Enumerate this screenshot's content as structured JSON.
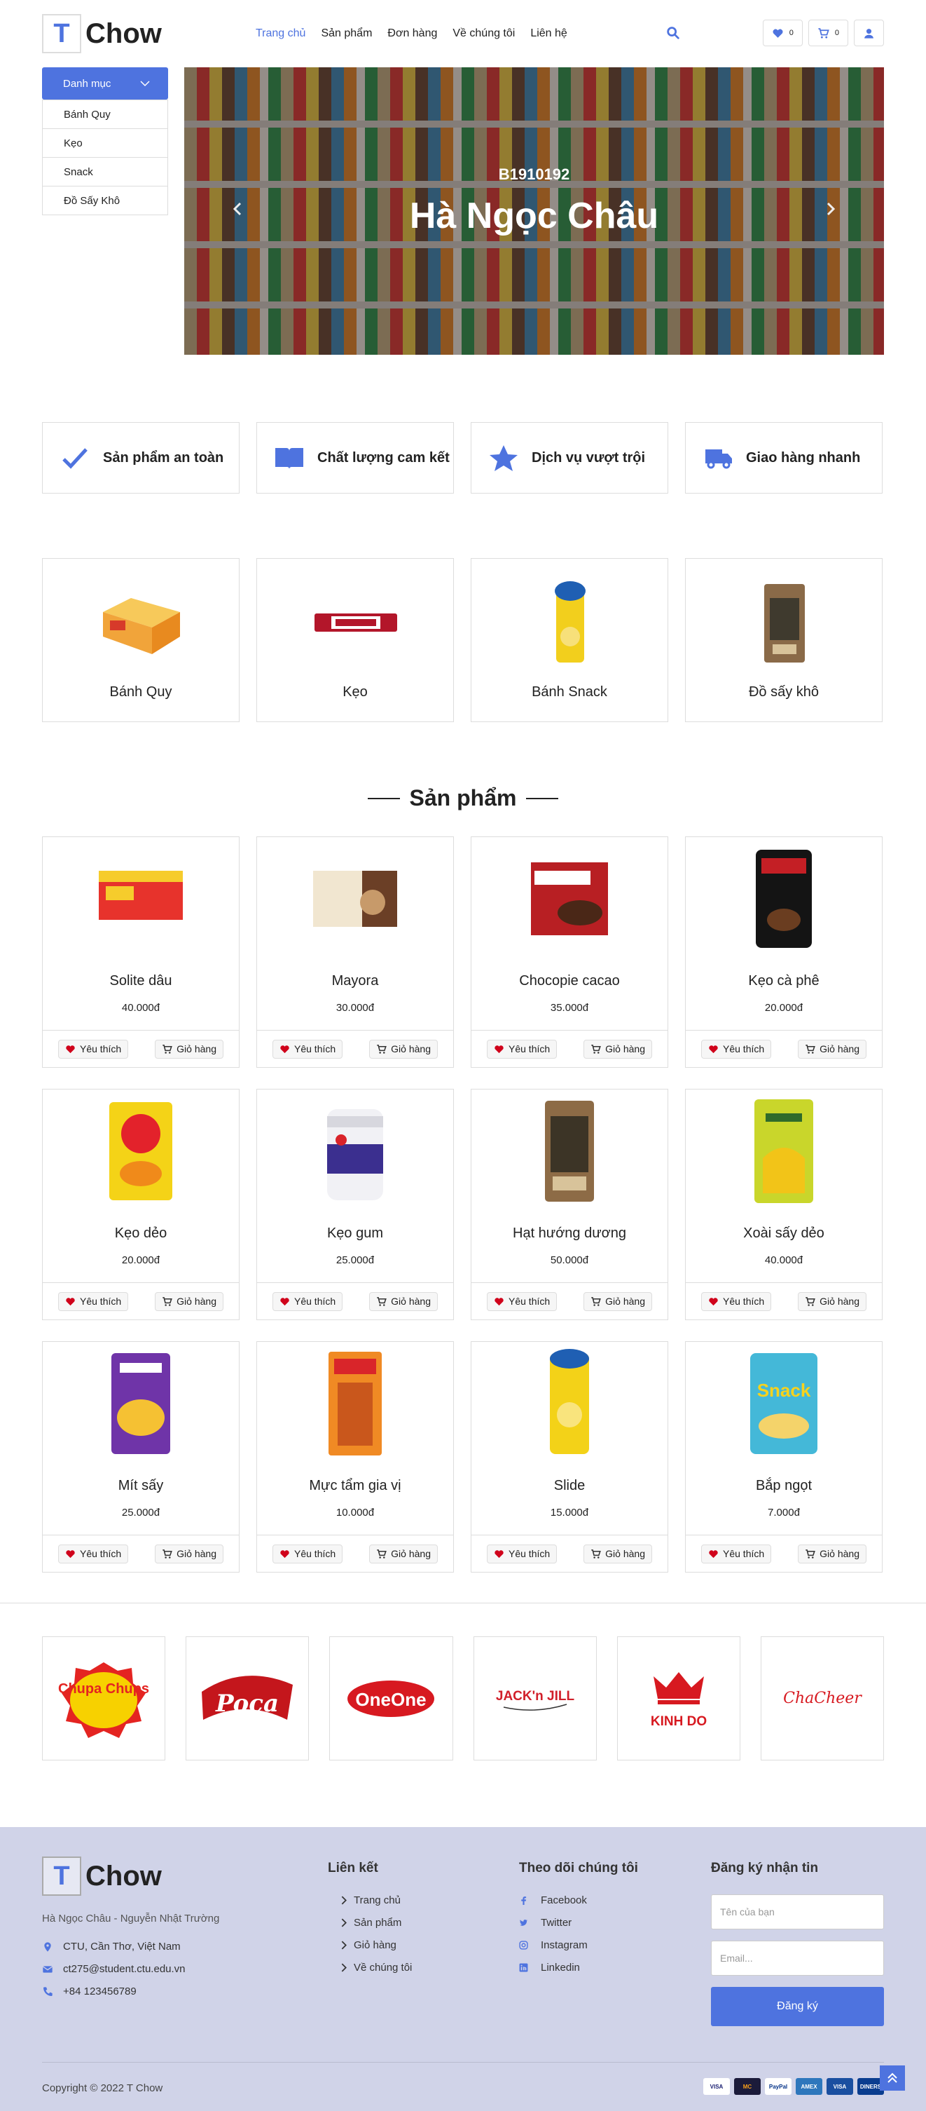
{
  "header": {
    "logo_letter": "T",
    "logo_text": "Chow",
    "nav": [
      "Trang chủ",
      "Sản phẩm",
      "Đơn hàng",
      "Về chúng tôi",
      "Liên hệ"
    ],
    "wishlist_count": "0",
    "cart_count": "0"
  },
  "sidebar": {
    "title": "Danh mục",
    "items": [
      "Bánh Quy",
      "Kẹo",
      "Snack",
      "Đồ Sấy Khô"
    ]
  },
  "hero": {
    "subtitle": "B1910192",
    "title": "Hà Ngọc Châu"
  },
  "features": [
    "Sản phẩm an toàn",
    "Chất lượng cam kết",
    "Dịch vụ vượt trội",
    "Giao hàng nhanh"
  ],
  "categories": [
    "Bánh Quy",
    "Kẹo",
    "Bánh Snack",
    "Đồ sấy khô"
  ],
  "products_section": {
    "title": "Sản phẩm",
    "like_label": "Yêu thích",
    "cart_label": "Giỏ hàng",
    "items": [
      {
        "name": "Solite dâu",
        "price": "40.000đ"
      },
      {
        "name": "Mayora",
        "price": "30.000đ"
      },
      {
        "name": "Chocopie cacao",
        "price": "35.000đ"
      },
      {
        "name": "Kẹo cà phê",
        "price": "20.000đ"
      },
      {
        "name": "Kẹo dẻo",
        "price": "20.000đ"
      },
      {
        "name": "Kẹo gum",
        "price": "25.000đ"
      },
      {
        "name": "Hạt hướng dương",
        "price": "50.000đ"
      },
      {
        "name": "Xoài sấy dẻo",
        "price": "40.000đ"
      },
      {
        "name": "Mít sấy",
        "price": "25.000đ"
      },
      {
        "name": "Mực tẩm gia vị",
        "price": "10.000đ"
      },
      {
        "name": "Slide",
        "price": "15.000đ"
      },
      {
        "name": "Bắp ngọt",
        "price": "7.000đ"
      }
    ]
  },
  "brands": [
    "Chupa Chups",
    "Poca",
    "OneOne",
    "JACK'n JILL",
    "KINH DO",
    "ChaCheer"
  ],
  "footer": {
    "logo_letter": "T",
    "logo_text": "Chow",
    "owners": "Hà Ngọc Châu - Nguyễn Nhật Trường",
    "address": "CTU, Cần Thơ, Việt Nam",
    "email": "ct275@student.ctu.edu.vn",
    "phone": "+84 123456789",
    "links_title": "Liên kết",
    "links": [
      "Trang chủ",
      "Sản phẩm",
      "Giỏ hàng",
      "Về chúng tôi"
    ],
    "follow_title": "Theo dõi chúng tôi",
    "social": [
      "Facebook",
      "Twitter",
      "Instagram",
      "Linkedin"
    ],
    "newsletter_title": "Đăng ký nhận tin",
    "name_placeholder": "Tên của bạn",
    "email_placeholder": "Email...",
    "subscribe_label": "Đăng ký",
    "copyright": "Copyright © 2022 T Chow",
    "payments": [
      "VISA",
      "MC",
      "PayPal",
      "AMEX",
      "VISA",
      "DINERS"
    ]
  },
  "colors": {
    "accent": "#4e73df",
    "footer_bg": "#d0d3e8"
  }
}
